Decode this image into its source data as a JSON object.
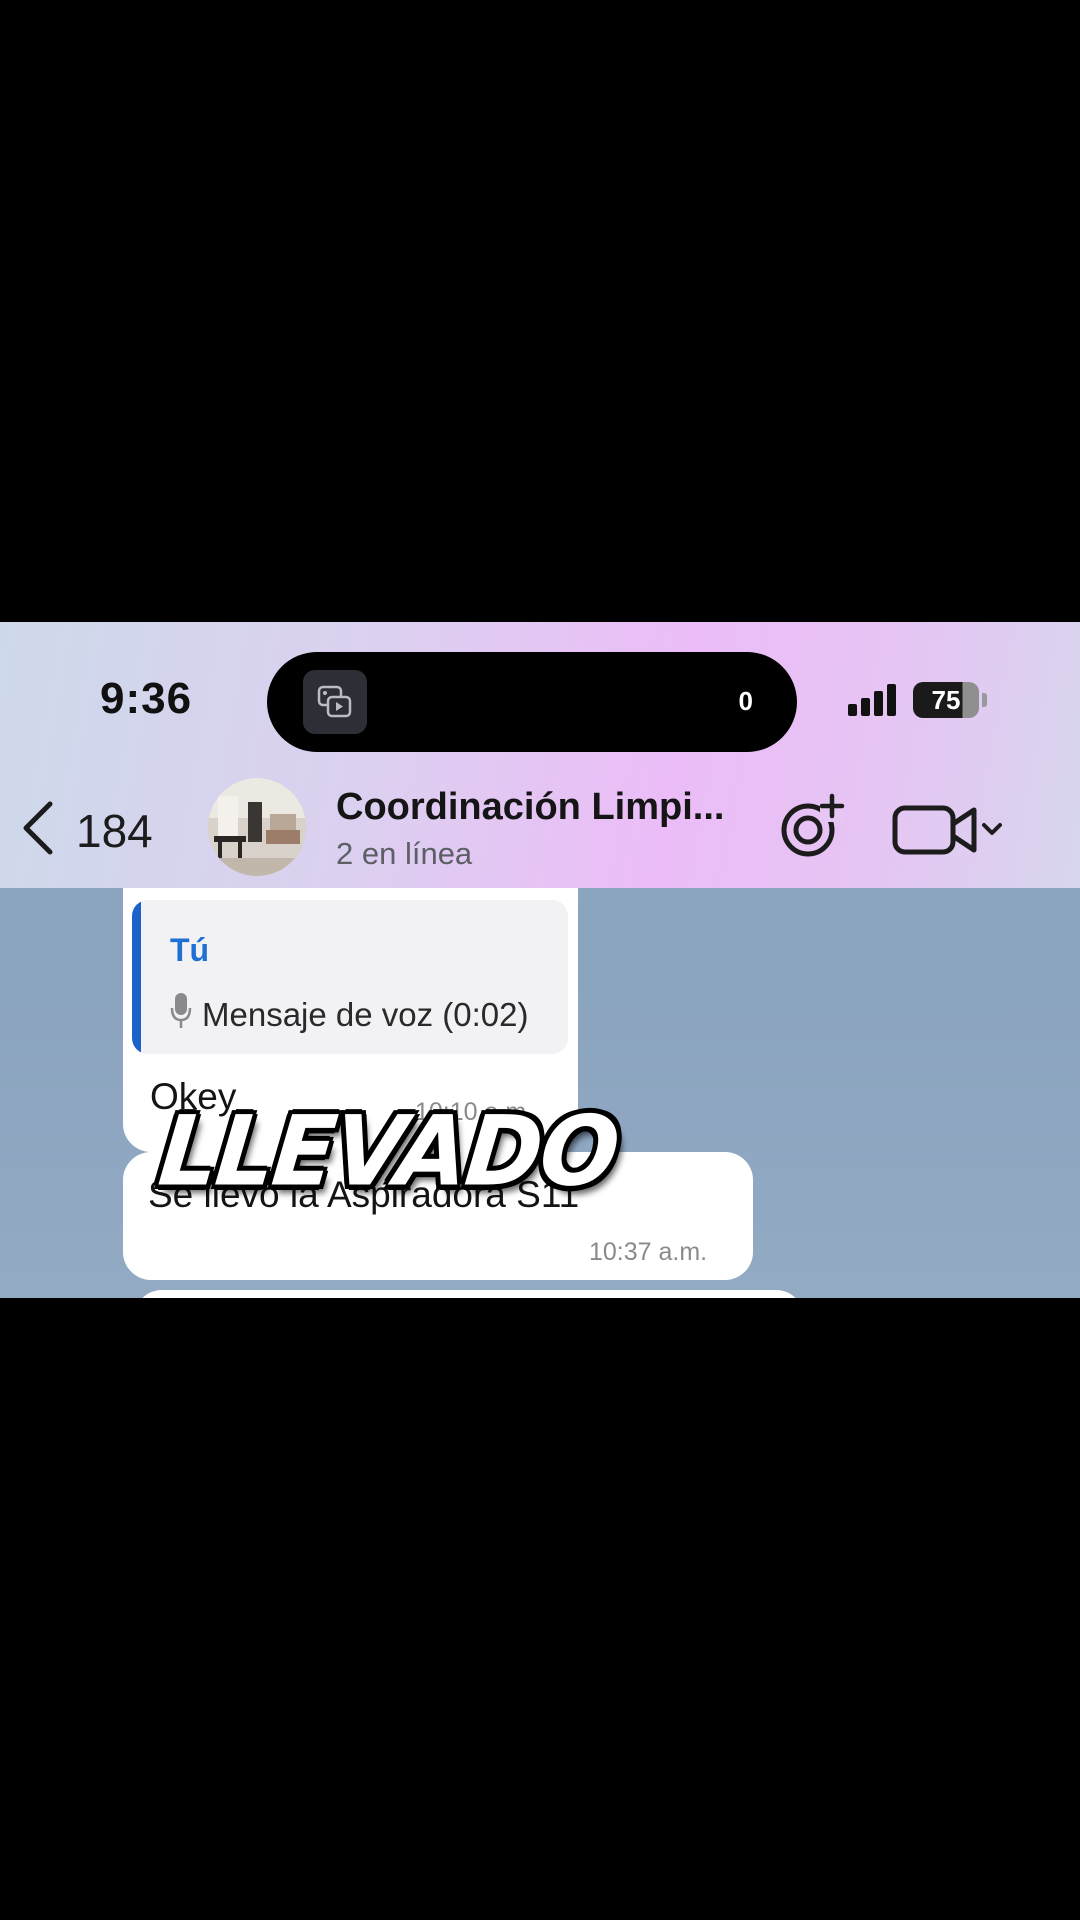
{
  "status_bar": {
    "time": "9:36",
    "island_count": "0",
    "battery": "75"
  },
  "header": {
    "back_count": "184",
    "title": "Coordinación Limpi...",
    "subtitle": "2 en línea"
  },
  "messages": [
    {
      "reply_author": "Tú",
      "reply_text": "Mensaje de voz (0:02)",
      "text": "Okey",
      "time": "10:10 a.m."
    },
    {
      "text": "Se llevó la Aspiradora S11",
      "time": "10:37 a.m."
    }
  ],
  "caption": "LLEVADO",
  "colors": {
    "accent": "#2070d3",
    "chat_bg": "#8aa3bf",
    "header_tint": "#ebbcf7"
  }
}
